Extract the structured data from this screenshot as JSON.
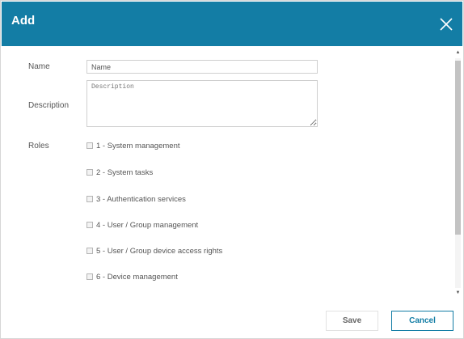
{
  "dialog": {
    "title": "Add"
  },
  "form": {
    "name_label": "Name",
    "name_placeholder": "Name",
    "description_label": "Description",
    "description_placeholder": "Description",
    "roles_label": "Roles",
    "roles": [
      {
        "label": "1 - System management",
        "checked": false
      },
      {
        "label": "2 - System tasks",
        "checked": false
      },
      {
        "label": "3 - Authentication services",
        "checked": false
      },
      {
        "label": "4 - User / Group management",
        "checked": false
      },
      {
        "label": "5 - User / Group device access rights",
        "checked": false
      },
      {
        "label": "6 - Device management",
        "checked": false
      }
    ]
  },
  "footer": {
    "save_label": "Save",
    "cancel_label": "Cancel"
  },
  "colors": {
    "titlebar": "#137da5",
    "cancel_accent": "#137da5"
  },
  "icons": {
    "close": "close-icon",
    "scroll_up": "chevron-up-icon",
    "scroll_down": "chevron-down-icon"
  }
}
